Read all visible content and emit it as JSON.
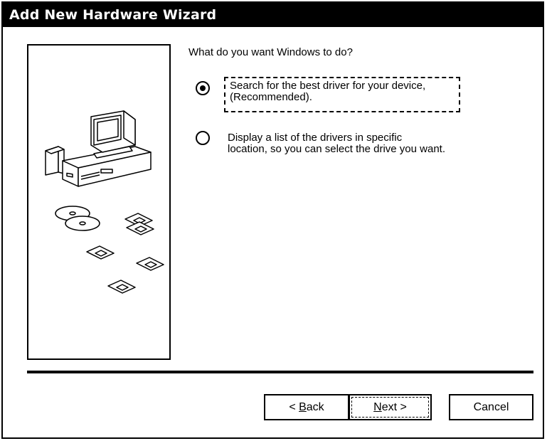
{
  "window": {
    "title": "Add New Hardware Wizard"
  },
  "main": {
    "question": "What do you want Windows to do?",
    "options": [
      {
        "line1": "Search for the best driver for your device,",
        "line2": "(Recommended).",
        "selected": true
      },
      {
        "line1": "Display a list of the drivers in specific",
        "line2": "location, so you can select the drive you want.",
        "selected": false
      }
    ]
  },
  "illustration": {
    "icons": [
      "computer-icon",
      "cd-disc-icon",
      "floppy-disk-icon"
    ]
  },
  "buttons": {
    "back_prefix": "< ",
    "back_key": "B",
    "back_rest": "ack",
    "next_key": "N",
    "next_rest": "ext >",
    "cancel": "Cancel"
  }
}
